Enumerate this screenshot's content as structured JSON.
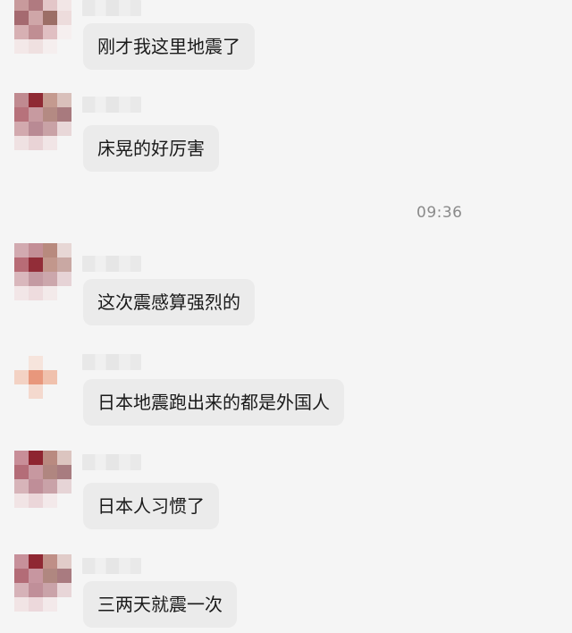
{
  "conversation": {
    "timestamp": "09:36",
    "messages": [
      {
        "text": "刚才我这里地震了",
        "sender_name": "",
        "avatar": "pixelated-avatar-1"
      },
      {
        "text": "床晃的好厉害",
        "sender_name": "",
        "avatar": "pixelated-avatar-2"
      },
      {
        "text": "这次震感算强烈的",
        "sender_name": "",
        "avatar": "pixelated-avatar-3"
      },
      {
        "text": "日本地震跑出来的都是外国人",
        "sender_name": "",
        "avatar": "pixelated-avatar-4"
      },
      {
        "text": "日本人习惯了",
        "sender_name": "",
        "avatar": "pixelated-avatar-5"
      },
      {
        "text": "三两天就震一次",
        "sender_name": "",
        "avatar": "pixelated-avatar-6"
      }
    ]
  },
  "colors": {
    "background": "#f5f5f5",
    "bubble": "#ebebeb",
    "text": "#1a1a1a",
    "timestamp": "#8a8a8a"
  }
}
